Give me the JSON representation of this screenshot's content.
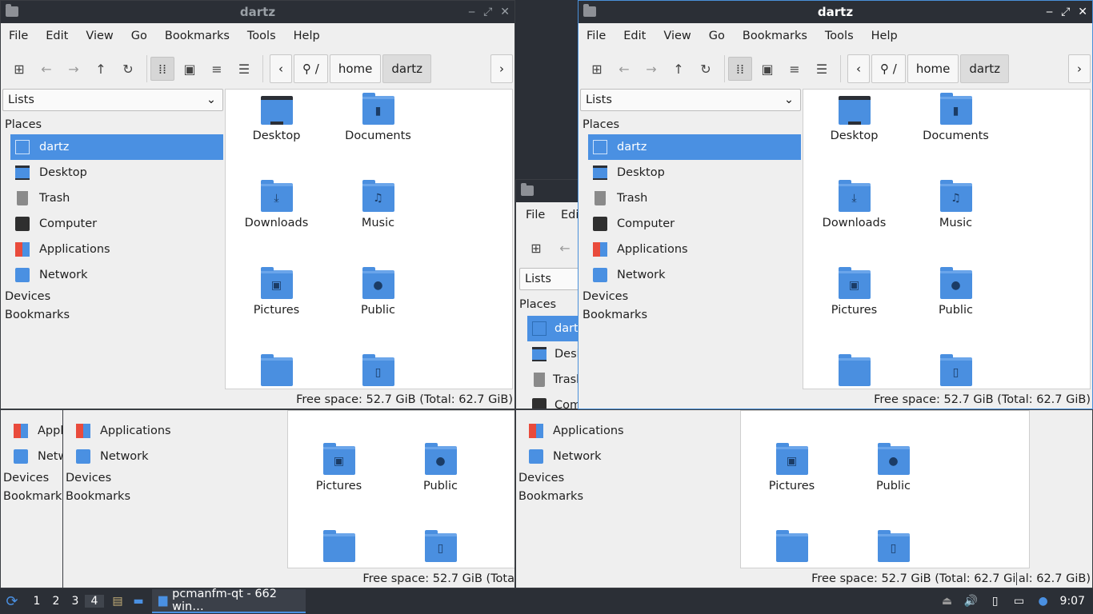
{
  "title": "dartz",
  "menu": [
    "File",
    "Edit",
    "View",
    "Go",
    "Bookmarks",
    "Tools",
    "Help"
  ],
  "path": {
    "root": "/",
    "segments": [
      "home",
      "dartz"
    ]
  },
  "sidebar": {
    "combo": "Lists",
    "places_label": "Places",
    "places": [
      "dartz",
      "Desktop",
      "Trash",
      "Computer",
      "Applications",
      "Network"
    ],
    "devices_label": "Devices",
    "bookmarks_label": "Bookmarks"
  },
  "files": [
    "Desktop",
    "Documents",
    "Downloads",
    "Music",
    "Pictures",
    "Public"
  ],
  "status": "Free space: 52.7 GiB (Total: 62.7 GiB)",
  "bottom_left": {
    "applications": "Applications",
    "network": "Network",
    "appl_clip": "Appl",
    "netw_clip": "Netw",
    "devices": "Devices",
    "bookmarks": "Bookmarks",
    "status_clip": "Free space: 52.7 GiB (Tota"
  },
  "mid_clip": {
    "file": "File",
    "edi": "Edi",
    "dartz": "dartz",
    "desk": "Desk",
    "trash": "Trash",
    "comp": "Comp",
    "status_tail": "al: 62.7 GiB)"
  },
  "taskbar": {
    "workspaces": [
      "1",
      "2",
      "3",
      "4"
    ],
    "active_workspace": "4",
    "task_label": "pcmanfm-qt - 662 win…",
    "clock": "9:07"
  },
  "colors": {
    "accent": "#4a90e2",
    "titlebar": "#2b2f36",
    "folder": "#4a8fe0"
  },
  "icons": [
    "new-tab-icon",
    "back-icon",
    "forward-icon",
    "up-icon",
    "reload-icon",
    "icon-view-icon",
    "thumbnail-view-icon",
    "compact-view-icon",
    "detailed-list-icon",
    "volume-icon",
    "network-icon",
    "notification-icon",
    "menu-logo-icon",
    "file-manager-icon"
  ]
}
